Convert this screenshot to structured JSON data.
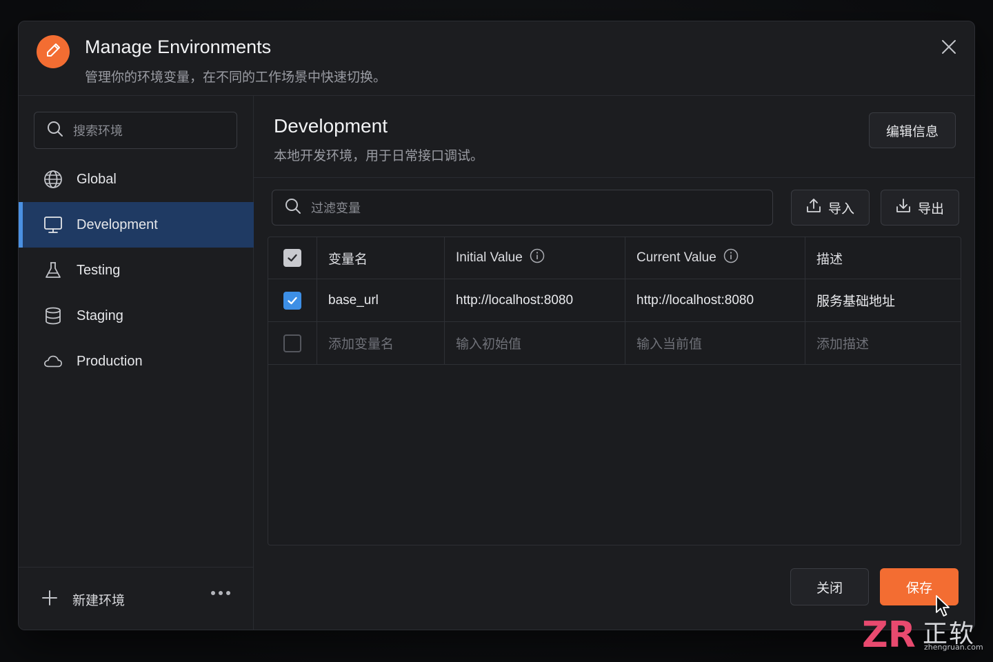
{
  "dialog": {
    "title": "Manage Environments",
    "subtitle": "管理你的环境变量，在不同的工作场景中快速切换。",
    "logo_icon": "pen-icon",
    "brand_color": "#f36d32"
  },
  "sidebar": {
    "search_placeholder": "搜索环境",
    "items": [
      {
        "label": "Global",
        "icon": "globe-icon",
        "active": false
      },
      {
        "label": "Development",
        "icon": "monitor-icon",
        "active": true
      },
      {
        "label": "Testing",
        "icon": "flask-icon",
        "active": false
      },
      {
        "label": "Staging",
        "icon": "database-icon",
        "active": false
      },
      {
        "label": "Production",
        "icon": "cloud-icon",
        "active": false
      }
    ],
    "new_env_label": "新建环境"
  },
  "main": {
    "env_title": "Development",
    "env_description": "本地开发环境，用于日常接口调试。",
    "edit_info_label": "编辑信息",
    "filter_placeholder": "过滤变量",
    "import_label": "导入",
    "export_label": "导出",
    "table": {
      "headers": [
        "变量名",
        "Initial Value",
        "Current Value",
        "描述"
      ],
      "rows": [
        {
          "checked": true,
          "name": "base_url",
          "initial": "http://localhost:8080",
          "current": "http://localhost:8080",
          "description": "服务基础地址"
        }
      ],
      "placeholder_row": {
        "name": "添加变量名",
        "initial": "输入初始值",
        "current": "输入当前值",
        "description": "添加描述"
      }
    },
    "close_label": "关闭",
    "save_label": "保存"
  },
  "watermark": {
    "logo_text": "ZR",
    "cn_text": "正软",
    "url_text": "zhengruan.com"
  },
  "colors": {
    "accent": "#f36d32",
    "active_bg": "#1f3a63",
    "active_bar": "#4a90e2",
    "checkbox_checked": "#3d8fe6"
  }
}
